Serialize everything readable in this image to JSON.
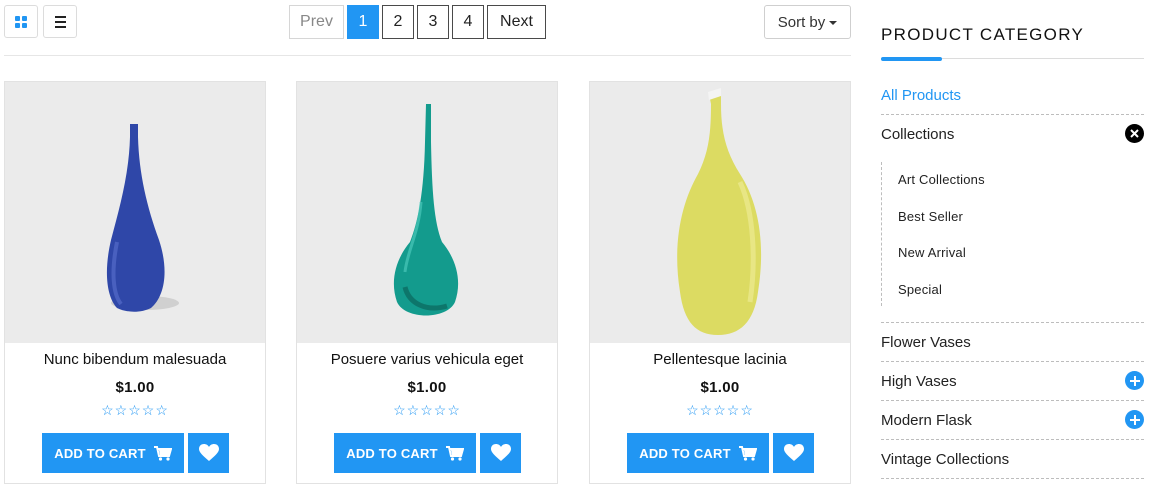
{
  "toolbar": {
    "grid_icon": "grid-icon",
    "list_icon": "list-icon",
    "pagination": {
      "prev_label": "Prev",
      "pages": [
        "1",
        "2",
        "3",
        "4"
      ],
      "active_page": "1",
      "next_label": "Next"
    },
    "sort_label": "Sort by"
  },
  "products": [
    {
      "title": "Nunc bibendum malesuada",
      "price": "$1.00",
      "rating": 0,
      "stars": "☆☆☆☆☆",
      "cart_label": "ADD TO CART",
      "vase_color": "#2f47a8"
    },
    {
      "title": "Posuere varius vehicula eget",
      "price": "$1.00",
      "rating": 0,
      "stars": "☆☆☆☆☆",
      "cart_label": "ADD TO CART",
      "vase_color": "#139b8d"
    },
    {
      "title": "Pellentesque lacinia",
      "price": "$1.00",
      "rating": 0,
      "stars": "☆☆☆☆☆",
      "cart_label": "ADD TO CART",
      "vase_color": "#dcdb62"
    }
  ],
  "sidebar": {
    "title": "PRODUCT CATEGORY",
    "categories": [
      {
        "label": "All Products",
        "active": true
      },
      {
        "label": "Collections",
        "expanded": true,
        "toggle": "close-icon",
        "children": [
          "Art Collections",
          "Best Seller",
          "New Arrival",
          "Special"
        ]
      },
      {
        "label": "Flower Vases"
      },
      {
        "label": "High Vases",
        "toggle": "plus-icon"
      },
      {
        "label": "Modern Flask",
        "toggle": "plus-icon"
      },
      {
        "label": "Vintage Collections"
      }
    ]
  },
  "colors": {
    "accent": "#2196f3",
    "image_bg": "#ebebeb"
  }
}
